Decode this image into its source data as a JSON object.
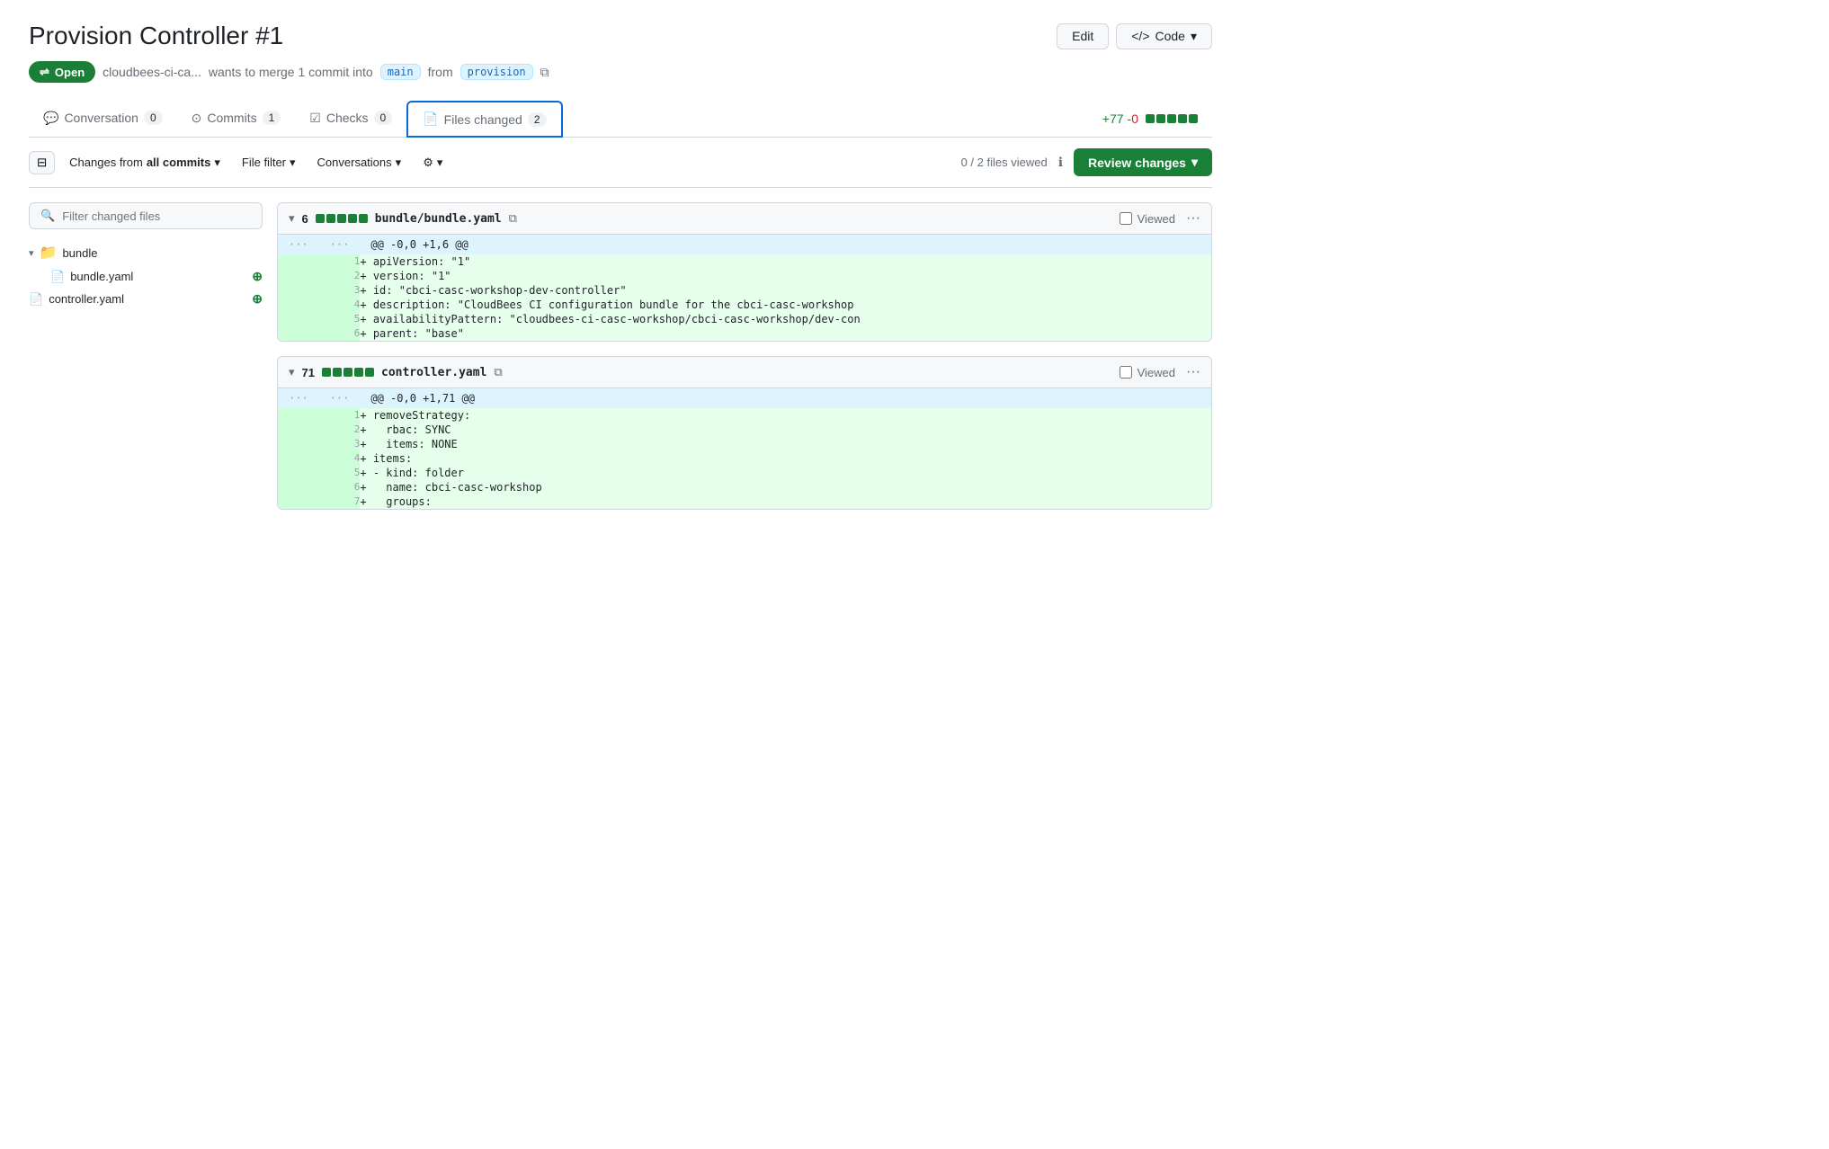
{
  "page": {
    "title": "Provision Controller #1"
  },
  "header": {
    "edit_label": "Edit",
    "code_label": "Code"
  },
  "pr_meta": {
    "status": "Open",
    "author": "cloudbees-ci-ca...",
    "merge_text": "wants to merge 1 commit into",
    "target_branch": "main",
    "from_text": "from",
    "source_branch": "provision"
  },
  "tabs": {
    "conversation": {
      "label": "Conversation",
      "count": "0"
    },
    "commits": {
      "label": "Commits",
      "count": "1"
    },
    "checks": {
      "label": "Checks",
      "count": "0"
    },
    "files_changed": {
      "label": "Files changed",
      "count": "2"
    }
  },
  "toolbar": {
    "changes_from": "Changes from",
    "all_commits": "all commits",
    "file_filter": "File filter",
    "conversations": "Conversations",
    "files_viewed": "0 / 2 files viewed",
    "review_changes": "Review changes"
  },
  "sidebar": {
    "search_placeholder": "Filter changed files",
    "folder_name": "bundle",
    "files": [
      {
        "name": "bundle.yaml",
        "type": "file",
        "added": true
      },
      {
        "name": "controller.yaml",
        "type": "file",
        "added": true
      }
    ]
  },
  "diff_files": [
    {
      "id": "bundle-yaml",
      "expand_icon": "▾",
      "count": "6",
      "squares": [
        5,
        0
      ],
      "filename": "bundle/bundle.yaml",
      "hunk_header": "@@ -0,0 +1,6 @@",
      "lines": [
        {
          "type": "ellipsis",
          "num1": "...",
          "num2": "..."
        },
        {
          "type": "added",
          "num": "1",
          "content": "+ apiVersion: \"1\""
        },
        {
          "type": "added",
          "num": "2",
          "content": "+ version: \"1\""
        },
        {
          "type": "added",
          "num": "3",
          "content": "+ id: \"cbci-casc-workshop-dev-controller\""
        },
        {
          "type": "added",
          "num": "4",
          "content": "+ description: \"CloudBees CI configuration bundle for the cbci-casc-workshop"
        },
        {
          "type": "added",
          "num": "5",
          "content": "+ availabilityPattern: \"cloudbees-ci-casc-workshop/cbci-casc-workshop/dev-con"
        },
        {
          "type": "added",
          "num": "6",
          "content": "+ parent: \"base\""
        }
      ]
    },
    {
      "id": "controller-yaml",
      "expand_icon": "▾",
      "count": "71",
      "squares": [
        5,
        0
      ],
      "filename": "controller.yaml",
      "hunk_header": "@@ -0,0 +1,71 @@",
      "lines": [
        {
          "type": "ellipsis",
          "num1": "...",
          "num2": "..."
        },
        {
          "type": "added",
          "num": "1",
          "content": "+ removeStrategy:"
        },
        {
          "type": "added",
          "num": "2",
          "content": "+   rbac: SYNC"
        },
        {
          "type": "added",
          "num": "3",
          "content": "+   items: NONE"
        },
        {
          "type": "added",
          "num": "4",
          "content": "+ items:"
        },
        {
          "type": "added",
          "num": "5",
          "content": "+ - kind: folder"
        },
        {
          "type": "added",
          "num": "6",
          "content": "+   name: cbci-casc-workshop"
        },
        {
          "type": "added",
          "num": "7",
          "content": "+   groups:"
        }
      ]
    }
  ],
  "icons": {
    "search": "🔍",
    "merge": "⇌",
    "file": "📄",
    "folder": "📁",
    "copy": "⧉",
    "info": "ℹ",
    "collapse": "⊟",
    "chevron_down": "▾"
  },
  "additions_stats": "+77",
  "deletions_stats": "-0",
  "diff_bar": {
    "green_count": 5,
    "gray_count": 0
  }
}
